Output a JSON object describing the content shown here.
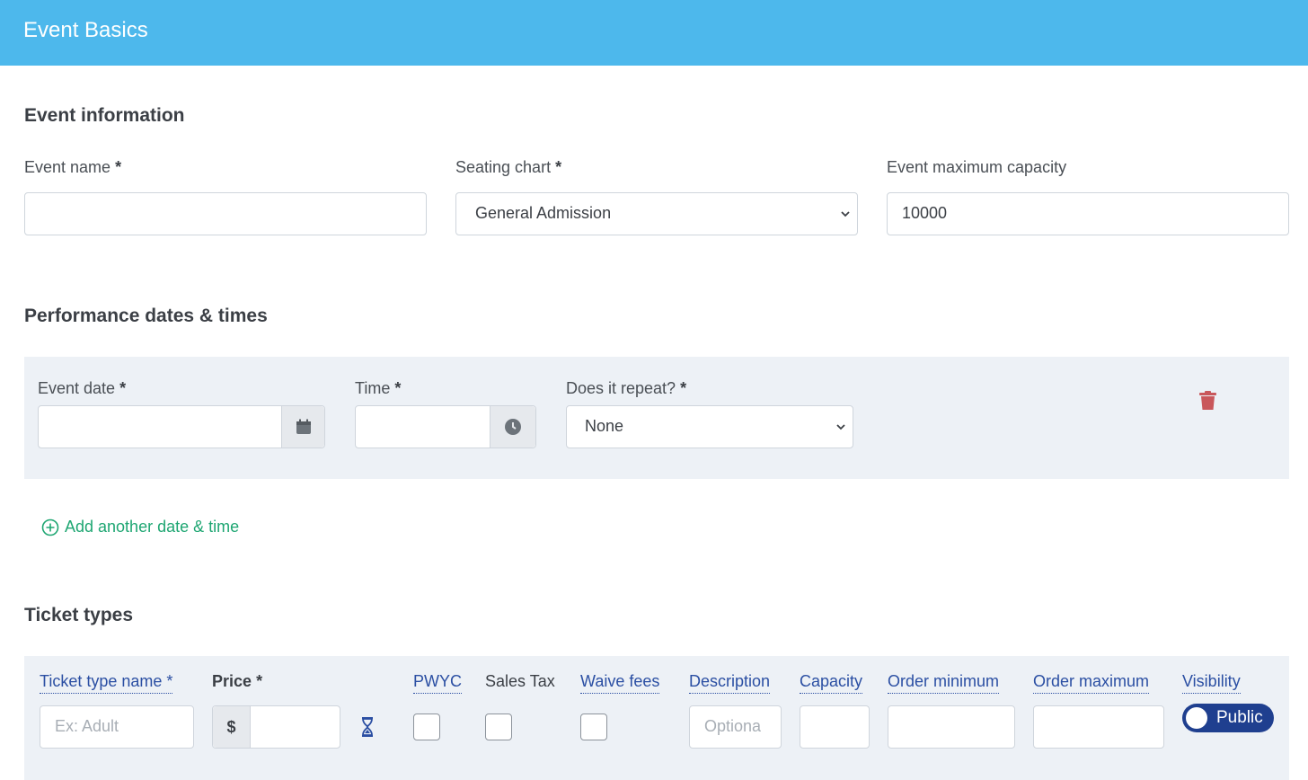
{
  "header": {
    "title": "Event Basics"
  },
  "event_info": {
    "title": "Event information",
    "event_name": {
      "label": "Event name",
      "required": "*",
      "value": ""
    },
    "seating_chart": {
      "label": "Seating chart",
      "required": "*",
      "value": "General Admission"
    },
    "max_capacity": {
      "label": "Event maximum capacity",
      "value": "10000"
    }
  },
  "performance": {
    "title": "Performance dates & times",
    "event_date": {
      "label": "Event date",
      "required": "*",
      "value": "",
      "icon": "calendar-icon"
    },
    "time": {
      "label": "Time",
      "required": "*",
      "value": "",
      "icon": "clock-icon"
    },
    "repeat": {
      "label": "Does it repeat?",
      "required": "*",
      "value": "None"
    },
    "delete_icon": "trash-icon",
    "add_link": "Add another date & time"
  },
  "tickets": {
    "title": "Ticket types",
    "columns": {
      "name": "Ticket type name",
      "name_req": "*",
      "price": "Price",
      "price_req": "*",
      "pwyc": "PWYC",
      "sales_tax": "Sales Tax",
      "waive_fees": "Waive fees",
      "description": "Description",
      "capacity": "Capacity",
      "order_min": "Order minimum",
      "order_max": "Order maximum",
      "visibility": "Visibility"
    },
    "row": {
      "name_placeholder": "Ex: Adult",
      "currency": "$",
      "description_placeholder": "Optiona",
      "visibility_value": "Public"
    }
  },
  "colors": {
    "header": "#4db8ec",
    "panel": "#edf1f6",
    "link_green": "#1ea672",
    "link_blue": "#2b4fa3",
    "toggle": "#1f3f8f",
    "trash": "#c9575b"
  }
}
